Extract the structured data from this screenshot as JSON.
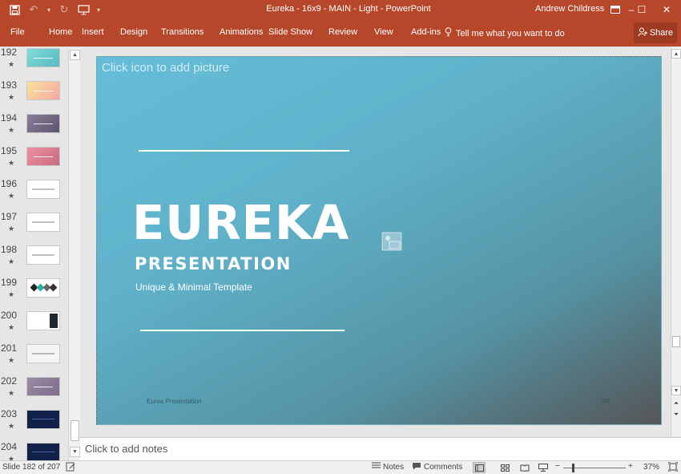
{
  "window": {
    "title": "Eureka - 16x9 - MAIN - Light  -  PowerPoint",
    "user": "Andrew Childress",
    "controls": {
      "restore_icon": "ribbon-display-icon",
      "minimize": "–",
      "maximize": "☐",
      "close": "✕"
    }
  },
  "qat": {
    "save": "save-icon",
    "undo": "undo-icon",
    "redo": "redo-icon",
    "present": "start-from-beginning-icon"
  },
  "ribbon": {
    "tabs": [
      "File",
      "Home",
      "Insert",
      "Design",
      "Transitions",
      "Animations",
      "Slide Show",
      "Review",
      "View",
      "Add-ins"
    ],
    "tell_me": "Tell me what you want to do",
    "share": "Share"
  },
  "thumbnails": [
    {
      "number": "192",
      "style": "teal"
    },
    {
      "number": "193",
      "style": "peach"
    },
    {
      "number": "194",
      "style": "mauve"
    },
    {
      "number": "195",
      "style": "rose"
    },
    {
      "number": "196",
      "style": "white-text"
    },
    {
      "number": "197",
      "style": "white-lines"
    },
    {
      "number": "198",
      "style": "white-card"
    },
    {
      "number": "199",
      "style": "diamonds"
    },
    {
      "number": "200",
      "style": "white-dark-panel"
    },
    {
      "number": "201",
      "style": "map"
    },
    {
      "number": "202",
      "style": "mauve-card"
    },
    {
      "number": "203",
      "style": "navy"
    },
    {
      "number": "204",
      "style": "navy"
    }
  ],
  "slide": {
    "picture_placeholder": "Click icon to add picture",
    "headline": "EUREKA",
    "subheadline": "PRESENTATION",
    "tagline": "Unique & Minimal Template",
    "footer_left": "Eurea Presentation",
    "footer_right": "182",
    "colors": {
      "gradient_start": "#65bdd7",
      "gradient_end": "#555658"
    }
  },
  "notes": {
    "placeholder": "Click to add notes"
  },
  "status": {
    "slide_info": "Slide 182 of 207",
    "notes": "Notes",
    "comments": "Comments",
    "zoom": "37%"
  }
}
